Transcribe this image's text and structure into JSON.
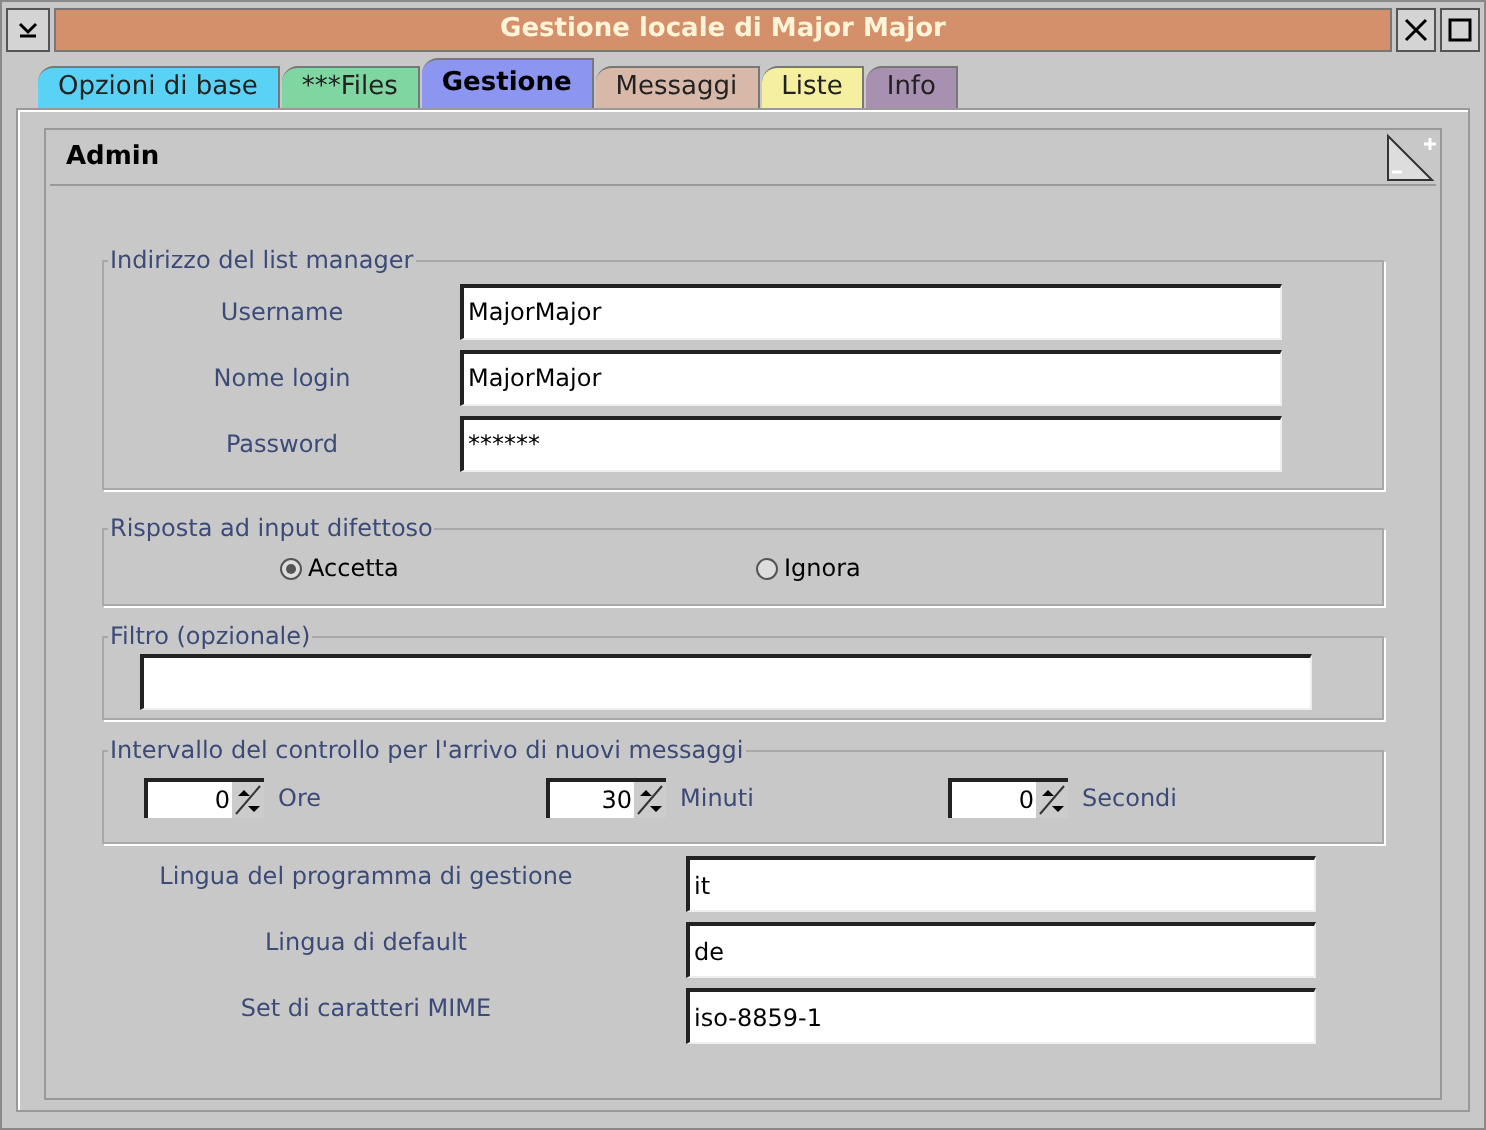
{
  "window": {
    "title": "Gestione locale di Major Major"
  },
  "tabs": [
    {
      "label": "Opzioni di base",
      "selected": false,
      "color": "#5ad2f5"
    },
    {
      "label": "***Files",
      "selected": false,
      "color": "#7fd6a0"
    },
    {
      "label": "Gestione",
      "selected": true,
      "color": "#8c96f0"
    },
    {
      "label": "Messaggi",
      "selected": false,
      "color": "#d8b8a8"
    },
    {
      "label": "Liste",
      "selected": false,
      "color": "#f4f0a0"
    },
    {
      "label": "Info",
      "selected": false,
      "color": "#a890b0"
    }
  ],
  "section": {
    "title": "Admin"
  },
  "list_manager": {
    "legend": "Indirizzo del list manager",
    "fields": [
      {
        "label": "Username",
        "value": "MajorMajor"
      },
      {
        "label": "Nome login",
        "value": "MajorMajor"
      },
      {
        "label": "Password",
        "value": "******"
      }
    ]
  },
  "bad_input": {
    "legend": "Risposta ad input difettoso",
    "options": [
      {
        "label": "Accetta",
        "selected": true
      },
      {
        "label": "Ignora",
        "selected": false
      }
    ]
  },
  "filter": {
    "legend": "Filtro (opzionale)"
  },
  "interval": {
    "legend": "Intervallo del controllo per l'arrivo di nuovi messaggi",
    "spinners": [
      {
        "value": "0",
        "unit": "Ore"
      },
      {
        "value": "30",
        "unit": "Minuti"
      },
      {
        "value": "0",
        "unit": "Secondi"
      }
    ]
  },
  "settings": [
    {
      "label": "Lingua del programma di gestione",
      "value": "it"
    },
    {
      "label": "Lingua di default",
      "value": "de"
    },
    {
      "label": "Set di caratteri MIME",
      "value": "iso-8859-1"
    }
  ]
}
